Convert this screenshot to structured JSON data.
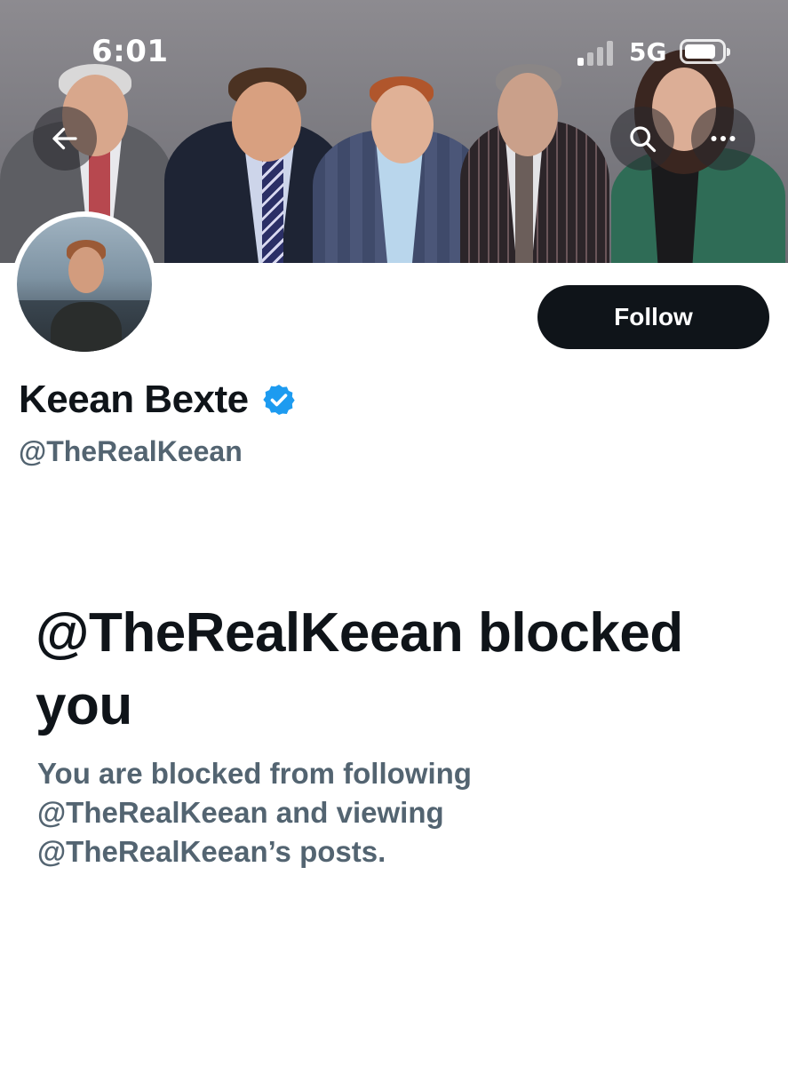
{
  "status_bar": {
    "time": "6:01",
    "network": "5G",
    "icons": [
      "signal-icon",
      "battery-icon"
    ]
  },
  "header": {
    "back_icon": "arrow-left-icon",
    "search_icon": "search-icon",
    "more_icon": "more-horizontal-icon"
  },
  "profile": {
    "display_name": "Keean Bexte",
    "handle": "@TheRealKeean",
    "verified_icon": "verified-badge-icon",
    "follow_label": "Follow"
  },
  "blocked": {
    "title": "@TheRealKeean blocked you",
    "description": "You are blocked from following @TheRealKeean and viewing @TheRealKeean’s posts."
  },
  "colors": {
    "primary_text": "#0f1419",
    "secondary_text": "#536471",
    "verified_blue": "#1d9bf0",
    "follow_bg": "#0f1419"
  }
}
